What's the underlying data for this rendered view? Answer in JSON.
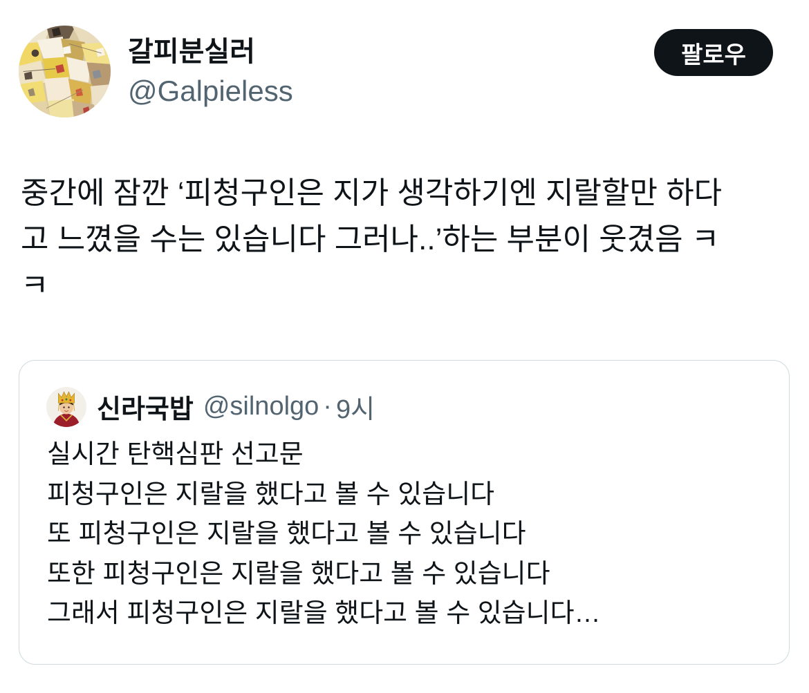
{
  "tweet": {
    "author": {
      "display_name": "갈피분실러",
      "handle": "@Galpieless"
    },
    "follow_button": {
      "label": "팔로우"
    },
    "text_lines": [
      "중간에 잠깐 ‘피청구인은 지가 생각하기엔 지랄할만 하다",
      "고 느꼈을 수는 있습니다 그러나..’하는 부분이 웃겼음 ㅋ",
      "ㅋ"
    ],
    "quoted_tweet": {
      "author": {
        "display_name": "신라국밥",
        "handle": "@silnolgo"
      },
      "separator": "·",
      "timestamp": "9시",
      "text_lines": [
        "실시간 탄핵심판 선고문",
        "피청구인은 지랄을 했다고 볼 수 있습니다",
        "또 피청구인은 지랄을 했다고 볼 수 있습니다",
        "또한 피청구인은 지랄을 했다고 볼 수 있습니다",
        "그래서 피청구인은 지랄을 했다고 볼 수 있습니다…"
      ]
    }
  },
  "colors": {
    "background": "#ffffff",
    "primary_text": "#0f1419",
    "secondary_text": "#536471",
    "border": "#cfd9de",
    "button_background": "#0f1419",
    "button_text": "#ffffff"
  }
}
